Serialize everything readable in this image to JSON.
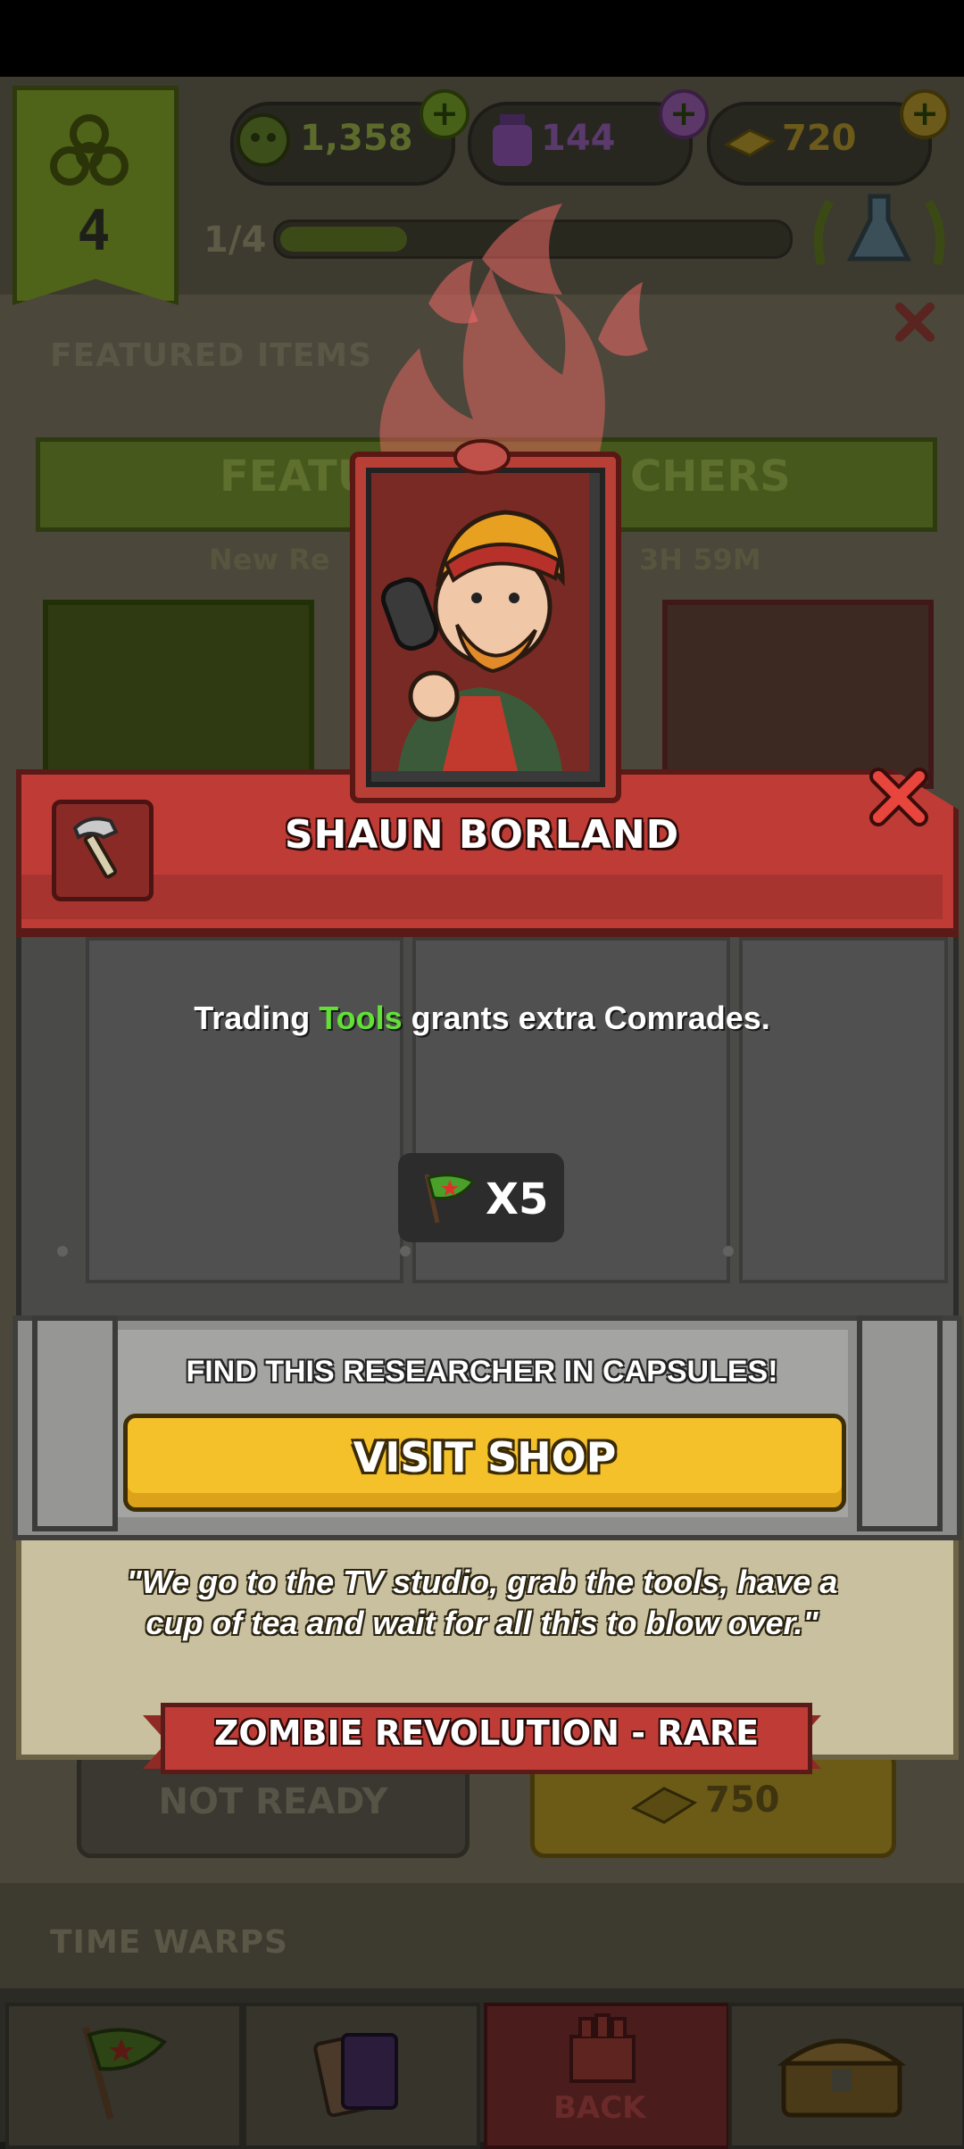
{
  "background": {
    "level": "4",
    "currencies": [
      {
        "icon": "zombie-head-icon",
        "value": "1,358"
      },
      {
        "icon": "potion-jar-icon",
        "value": "144"
      },
      {
        "icon": "gold-bars-icon",
        "value": "720"
      }
    ],
    "progress_label": "1/4",
    "progress_fraction": 0.25,
    "featured_title": "FEATURED ITEMS",
    "featured_strip_left": "FEATU",
    "featured_strip_right": "CHERS",
    "sub_left": "New Re",
    "sub_right": "3H 59M",
    "not_ready_label": "NOT READY",
    "price": "750",
    "time_warps_title": "TIME WARPS",
    "back_label": "BACK"
  },
  "dialog": {
    "title": "SHAUN BORLAND",
    "category_icon": "hammer-icon",
    "description_before": "Trading ",
    "description_highlight": "Tools",
    "description_after": " grants extra Comrades.",
    "reward_icon": "comrade-flag-icon",
    "reward_amount": "X5",
    "find_text": "FIND THIS RESEARCHER IN CAPSULES!",
    "button_label": "VISIT SHOP",
    "quote": "\"We go to the TV studio, grab the tools, have a cup of tea and wait for all this to blow over.\"",
    "rarity_label": "ZOMBIE REVOLUTION - RARE"
  },
  "colors": {
    "header_red": "#bf3c36",
    "highlight_green": "#62e036",
    "button_gold": "#f5c12a"
  }
}
